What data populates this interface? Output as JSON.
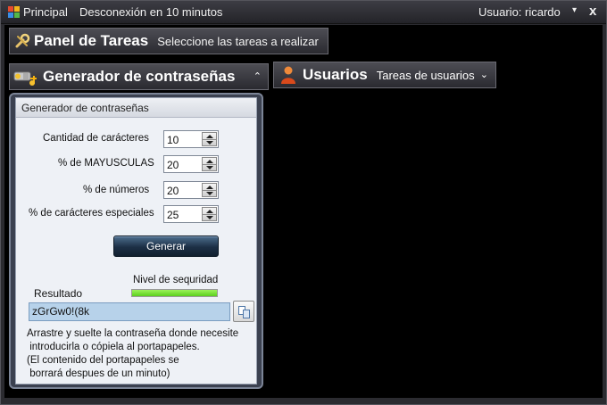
{
  "titlebar": {
    "menu_principal": "Principal",
    "disconnect_notice": "Desconexión en 10 minutos",
    "user": "Usuario: ricardo",
    "user_caret": "▾",
    "close": "x"
  },
  "task_panel": {
    "title": "Panel de Tareas",
    "subtitle": "Seleccione las tareas a realizar"
  },
  "generator": {
    "title": "Generador de contraseñas",
    "collapse_glyph": "⌃",
    "inner_title": "Generador de contraseñas",
    "fields": [
      {
        "label": "Cantidad de carácteres",
        "value": "10"
      },
      {
        "label": "% de MAYUSCULAS",
        "value": "20"
      },
      {
        "label": "% de números",
        "value": "20"
      },
      {
        "label": "% de carácteres especiales",
        "value": "25"
      }
    ],
    "generate_label": "Generar",
    "strength_label": "Nivel de sequridad",
    "strength_level": 1.0,
    "result_label": "Resultado",
    "result_value": "zGrGw0!(8k",
    "help_line1": "Arrastre y suelte la contraseña donde necesite",
    "help_line2": " introducirla o cópiela al portapapeles.",
    "help_line3": "(El contenido del portapapeles se",
    "help_line4": " borrará despues de un minuto)"
  },
  "users": {
    "title": "Usuarios",
    "subtitle": "Tareas de usuarios",
    "expand_glyph": "⌄"
  },
  "colors": {
    "window_bg": "#2b2b30",
    "content_bg": "#000000",
    "strength_fill": "#5cd01e",
    "result_bg": "#b7d2ea"
  }
}
